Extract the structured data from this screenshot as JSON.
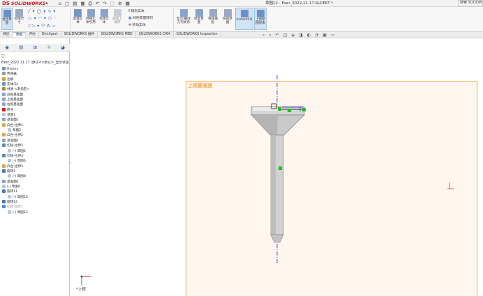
{
  "app": {
    "logo_mark": "DS",
    "logo_text": "SOLIDWORKS",
    "document_title": "草图12 - Exer_2022.11.17.SLDPRT *",
    "search_placeholder": "搜索 SOLIDWORKS"
  },
  "quick_access": [
    "⌂",
    "▢",
    "▤",
    "▦",
    "⎙",
    "↶",
    "↷",
    "⬚",
    "⚙",
    "▦"
  ],
  "ribbon": {
    "buttons": [
      {
        "label": "退出草图",
        "icon": "exit-sketch-icon"
      },
      {
        "label": "智能尺寸",
        "icon": "smart-dimension-icon"
      },
      {
        "label": "剪裁实体",
        "icon": "trim-entities-icon"
      },
      {
        "label": "转换实体引用",
        "icon": "convert-entities-icon"
      },
      {
        "label": "等距实体",
        "icon": "offset-entities-icon"
      },
      {
        "label": "曲面上偏移",
        "icon": "offset-on-surface-icon"
      },
      {
        "label": "显示/删除几何关系",
        "icon": "display-relations-icon"
      },
      {
        "label": "修复草图",
        "icon": "repair-sketch-icon"
      },
      {
        "label": "快速捕捉",
        "icon": "quick-snaps-icon"
      },
      {
        "label": "快速草图",
        "icon": "rapid-sketch-icon"
      },
      {
        "label": "Instant2D",
        "icon": "instant2d-icon"
      },
      {
        "label": "上色草图轮廓",
        "icon": "shaded-sketch-icon"
      }
    ],
    "side_items": [
      "镜向实体",
      "线性草图阵列",
      "移动实体"
    ]
  },
  "tabs": [
    "特征",
    "草图",
    "评估",
    "DimXpert",
    "SOLIDWORKS 插件",
    "SOLIDWORKS MBD",
    "SOLIDWORKS CAM",
    "SOLIDWORKS Inspection"
  ],
  "panel": {
    "tab_icons": [
      "feature-manager-icon",
      "property-manager-icon",
      "configuration-manager-icon",
      "dimxpert-icon",
      "display-manager-icon"
    ],
    "root": "Exer_2022.11.17 (默认<<默认>_显示状态",
    "tree": [
      {
        "label": "History",
        "level": 0,
        "icon": "history-icon"
      },
      {
        "label": "传感器",
        "level": 0,
        "icon": "sensor-icon"
      },
      {
        "label": "注解",
        "level": 0,
        "icon": "annotation-icon"
      },
      {
        "label": "实体(5)",
        "level": 0,
        "icon": "solid-bodies-icon"
      },
      {
        "label": "材质 <未指定>",
        "level": 0,
        "icon": "material-icon"
      },
      {
        "label": "前视基准面",
        "level": 0,
        "icon": "plane-icon"
      },
      {
        "label": "上视基准面",
        "level": 0,
        "icon": "plane-icon"
      },
      {
        "label": "右视基准面",
        "level": 0,
        "icon": "plane-icon"
      },
      {
        "label": "原点",
        "level": 0,
        "icon": "origin-icon"
      },
      {
        "label": "草图1",
        "level": 0,
        "icon": "sketch-icon"
      },
      {
        "label": "基准面1",
        "level": 0,
        "icon": "plane-icon"
      },
      {
        "label": "凸台-拉伸1",
        "level": 0,
        "icon": "extrude-icon"
      },
      {
        "label": "草图2",
        "level": 1,
        "icon": "sketch-icon"
      },
      {
        "label": "凸台-拉伸2",
        "level": 0,
        "icon": "extrude-icon"
      },
      {
        "label": "基准面2",
        "level": 0,
        "icon": "plane-icon"
      },
      {
        "label": "切除-拉伸2",
        "level": 0,
        "icon": "cut-icon"
      },
      {
        "label": "(-) 草图5",
        "level": 1,
        "icon": "sketch-icon"
      },
      {
        "label": "切除-拉伸3",
        "level": 0,
        "icon": "cut-icon"
      },
      {
        "label": "(-) 草图6",
        "level": 1,
        "icon": "sketch-icon"
      },
      {
        "label": "凸台-拉伸3",
        "level": 0,
        "icon": "extrude-icon"
      },
      {
        "label": "旋转2",
        "level": 0,
        "icon": "revolve-icon"
      },
      {
        "label": "(-) 草图8",
        "level": 1,
        "icon": "sketch-icon"
      },
      {
        "label": "基准面4",
        "level": 0,
        "icon": "plane-icon"
      },
      {
        "label": "(-) 草图9",
        "level": 0,
        "icon": "sketch-icon"
      },
      {
        "label": "旋转11",
        "level": 0,
        "icon": "revolve-icon"
      },
      {
        "label": "(-) 草图10",
        "level": 1,
        "icon": "sketch-icon"
      },
      {
        "label": "旋转14",
        "level": 0,
        "icon": "revolve-icon"
      },
      {
        "label": "切除-旋转1",
        "level": 0,
        "icon": "cut-icon",
        "dim": true
      },
      {
        "label": "(-) 草图12",
        "level": 1,
        "icon": "sketch-icon"
      }
    ]
  },
  "viewport": {
    "plane_label": "上视基准面",
    "view_tool_icons": [
      "zoom-fit-icon",
      "zoom-area-icon",
      "previous-view-icon",
      "section-view-icon",
      "view-orientation-icon",
      "display-style-icon",
      "hide-show-icon",
      "appearance-icon",
      "scene-icon",
      "view-settings-icon"
    ],
    "triad_label": "*上视"
  },
  "colors": {
    "accent": "#f0a447",
    "plane_fill": "#fff7ef",
    "part_gray": "#c9c9c9",
    "centerline": "#3333cc",
    "sketch_green": "#22bb22",
    "axis_red": "#d8161d"
  }
}
